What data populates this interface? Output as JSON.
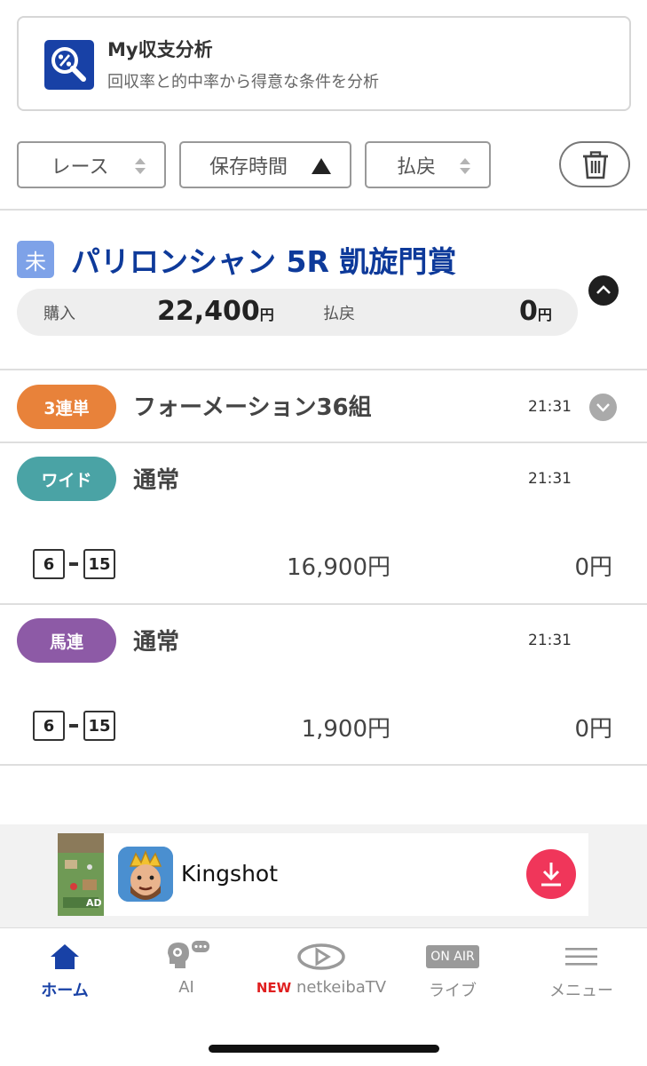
{
  "analysis": {
    "title": "My収支分析",
    "subtitle": "回収率と的中率から得意な条件を分析",
    "icon": "percent-search-icon"
  },
  "sort": {
    "race_label": "レース",
    "saved_time_label": "保存時間",
    "payout_label": "払戻",
    "active": "saved_time"
  },
  "race": {
    "status": "未",
    "title": "パリロンシャン 5R 凱旋門賞",
    "purchase_label": "購入",
    "purchase_value": "22,400",
    "payout_label": "払戻",
    "payout_value": "0",
    "yen": "円"
  },
  "bets": [
    {
      "type": "3連単",
      "type_color": "#e8823a",
      "desc": "フォーメーション36組",
      "time": "21:31",
      "collapsed": true
    },
    {
      "type": "ワイド",
      "type_color": "#4aa3a5",
      "desc": "通常",
      "time": "21:31",
      "combo": [
        "6",
        "15"
      ],
      "stake": "16,900円",
      "payout": "0円"
    },
    {
      "type": "馬連",
      "type_color": "#8d5aa6",
      "desc": "通常",
      "time": "21:31",
      "combo": [
        "6",
        "15"
      ],
      "stake": "1,900円",
      "payout": "0円"
    }
  ],
  "ad": {
    "app_name": "Kingshot",
    "badge": "AD"
  },
  "nav": {
    "home": "ホーム",
    "ai": "AI",
    "tv_new": "NEW",
    "tv": "netkeibaTV",
    "live_badge": "ON AIR",
    "live": "ライブ",
    "menu": "メニュー",
    "active_color": "#1841a6"
  }
}
